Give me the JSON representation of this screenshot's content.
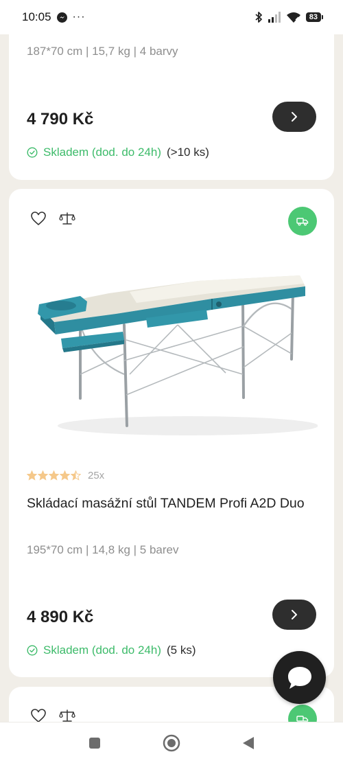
{
  "status_bar": {
    "time": "10:05",
    "icons": [
      "messenger-icon",
      "more-dots",
      "bluetooth-icon",
      "signal-icon",
      "wifi-icon"
    ],
    "more": "···",
    "battery": "83"
  },
  "products": [
    {
      "specs": "187*70 cm | 15,7 kg | 4 barvy",
      "price": "4 790 Kč",
      "stock_label": "Skladem (dod. do 24h)",
      "stock_qty": "(>10 ks)"
    },
    {
      "rating_value": 4.5,
      "review_count": "25x",
      "title": "Skládací masážní stůl TANDEM Profi A2D Duo",
      "specs": "195*70 cm | 14,8 kg | 5 barev",
      "price": "4 890 Kč",
      "stock_label": "Skladem (dod. do 24h)",
      "stock_qty": "(5 ks)"
    }
  ],
  "colors": {
    "accent_green": "#3dbb6a",
    "badge_green": "#4cc874",
    "dark_button": "#2e2e2e",
    "star": "#f5c88a",
    "table_teal": "#2f8ea1"
  }
}
